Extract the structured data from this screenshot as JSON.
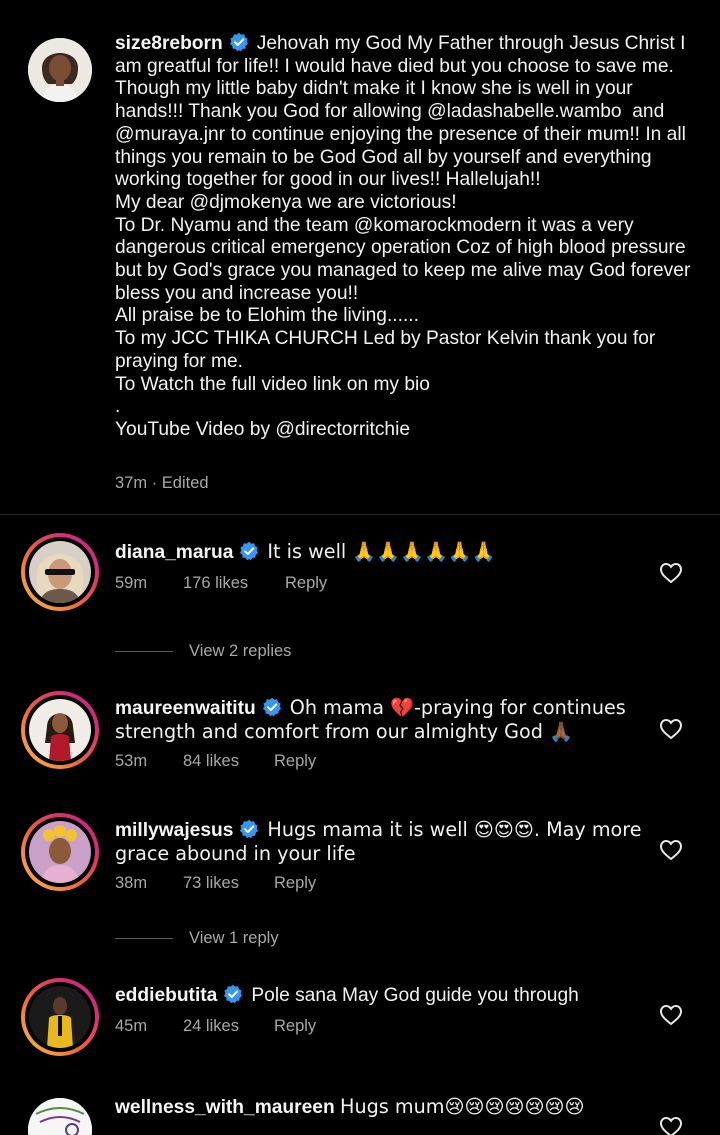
{
  "caption": {
    "username": "size8reborn",
    "text": "Jehovah my God My Father through Jesus Christ I am greatful for life!! I would have died but you choose to save me. Though my little baby didn't make it I know she is well in your hands!!! Thank you God for allowing @ladashabelle.wambo  and @muraya.jnr to continue enjoying the presence of their mum!! In all things you remain to be God God all by yourself and everything working together for good in our lives!! Hallelujah!!\nMy dear @djmokenya we are victorious!\nTo Dr. Nyamu and the team @komarockmodern it was a very dangerous critical emergency operation Coz of high blood pressure but by God's grace you managed to keep me alive may God forever bless you and increase you!!\nAll praise be to Elohim the living......\nTo my JCC THIKA CHURCH Led by Pastor Kelvin thank you for praying for me.\nTo Watch the full video link on my bio\n.\nYouTube Video by @directorritchie",
    "time": "37m",
    "edited": "· Edited"
  },
  "comments": [
    {
      "username": "diana_marua",
      "verified": true,
      "text": "It is well 🙏🙏🙏🙏🙏🙏",
      "time": "59m",
      "likes": "176 likes",
      "reply": "Reply",
      "view_replies": "View 2 replies"
    },
    {
      "username": "maureenwaititu",
      "verified": true,
      "text": "Oh mama 💔-praying for continues strength and comfort from our almighty God 🙏🏾",
      "time": "53m",
      "likes": "84 likes",
      "reply": "Reply"
    },
    {
      "username": "millywajesus",
      "verified": true,
      "text": "Hugs mama it is well 😍😍😍. May more grace abound in your life",
      "time": "38m",
      "likes": "73 likes",
      "reply": "Reply",
      "view_replies": "View 1 reply"
    },
    {
      "username": "eddiebutita",
      "verified": true,
      "text": "Pole sana May God guide you through",
      "time": "45m",
      "likes": "24 likes",
      "reply": "Reply"
    },
    {
      "username": "wellness_with_maureen",
      "verified": false,
      "text": "Hugs mum😢😢😢😢😢😢😢"
    }
  ],
  "colors": {
    "background": "#000000",
    "verified": "#3797f0",
    "muted": "#a8a8a8"
  }
}
